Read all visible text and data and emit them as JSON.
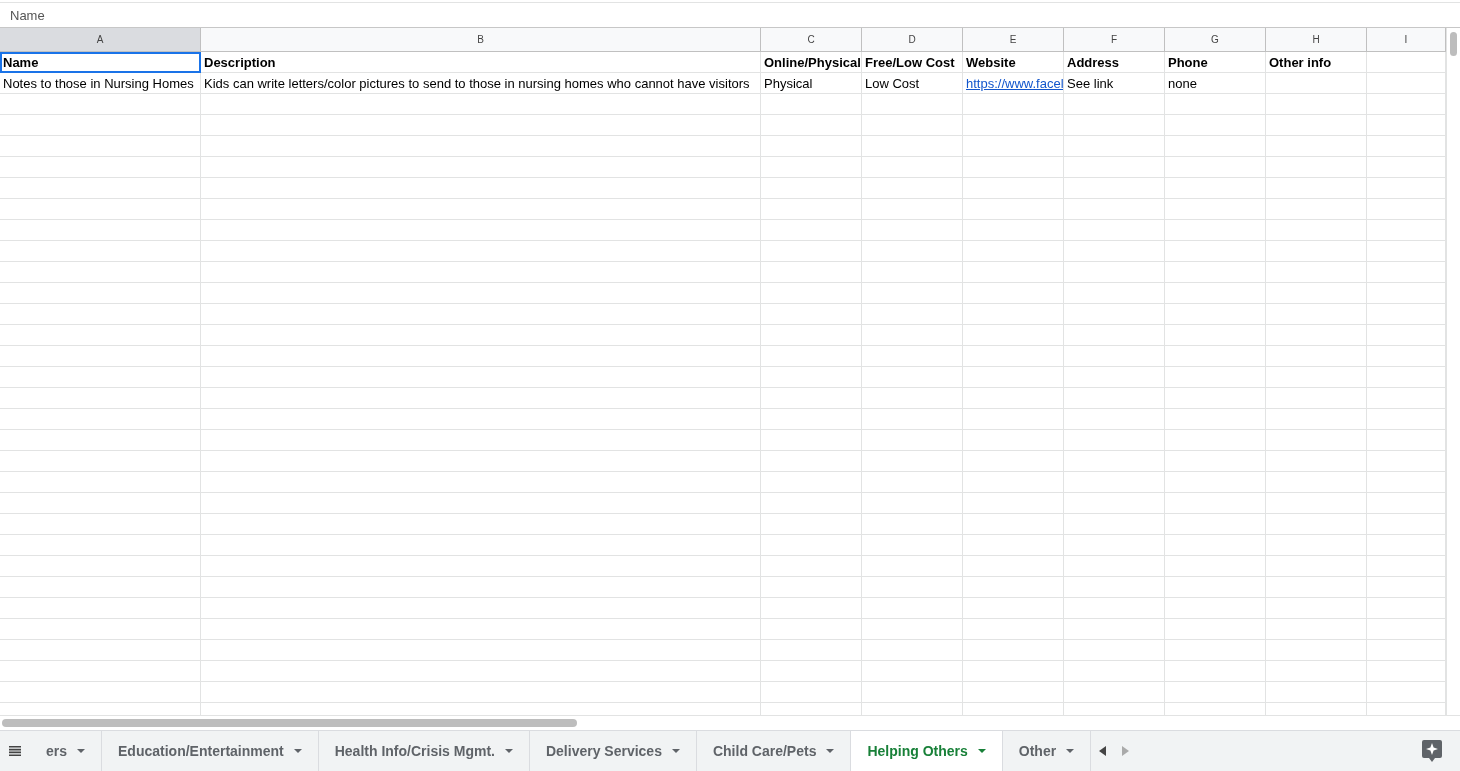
{
  "formula_bar": {
    "value": "Name"
  },
  "columns": [
    {
      "label": "A",
      "selected": true
    },
    {
      "label": "B",
      "selected": false
    },
    {
      "label": "C",
      "selected": false
    },
    {
      "label": "D",
      "selected": false
    },
    {
      "label": "E",
      "selected": false
    },
    {
      "label": "F",
      "selected": false
    },
    {
      "label": "G",
      "selected": false
    },
    {
      "label": "H",
      "selected": false
    },
    {
      "label": "I",
      "selected": false
    }
  ],
  "rows": [
    {
      "kind": "header",
      "cells": [
        {
          "text": "Name",
          "kind": "text",
          "selected": true
        },
        {
          "text": "Description",
          "kind": "text",
          "selected": false
        },
        {
          "text": "Online/Physical",
          "kind": "text",
          "selected": false
        },
        {
          "text": "Free/Low Cost",
          "kind": "text",
          "selected": false
        },
        {
          "text": "Website",
          "kind": "text",
          "selected": false
        },
        {
          "text": "Address",
          "kind": "text",
          "selected": false
        },
        {
          "text": "Phone",
          "kind": "text",
          "selected": false
        },
        {
          "text": "Other info",
          "kind": "text",
          "selected": false
        }
      ]
    },
    {
      "kind": "data",
      "cells": [
        {
          "text": "Notes to those in Nursing Homes",
          "kind": "text",
          "selected": false
        },
        {
          "text": "Kids can write letters/color pictures to send to those in nursing homes who cannot have visitors",
          "kind": "text",
          "selected": false
        },
        {
          "text": "Physical",
          "kind": "text",
          "selected": false
        },
        {
          "text": "Low Cost",
          "kind": "text",
          "selected": false
        },
        {
          "text": "https://www.facel",
          "kind": "link",
          "selected": false
        },
        {
          "text": "See link",
          "kind": "text",
          "selected": false
        },
        {
          "text": "none",
          "kind": "text",
          "selected": false
        },
        {
          "text": "",
          "kind": "text",
          "selected": false
        }
      ]
    }
  ],
  "sheet_tabs": [
    {
      "label": "ers",
      "selected": false
    },
    {
      "label": "Education/Entertainment",
      "selected": false
    },
    {
      "label": "Health Info/Crisis Mgmt.",
      "selected": false
    },
    {
      "label": "Delivery Services",
      "selected": false
    },
    {
      "label": "Child Care/Pets",
      "selected": false
    },
    {
      "label": "Helping Others",
      "selected": true
    },
    {
      "label": "Other",
      "selected": false
    }
  ]
}
